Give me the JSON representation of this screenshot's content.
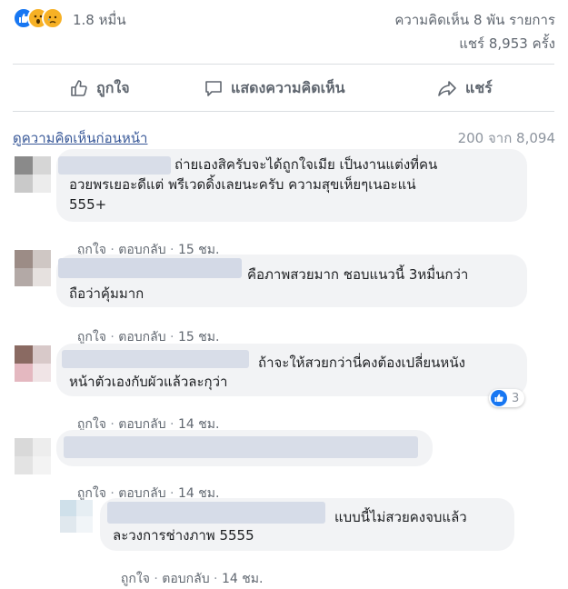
{
  "reactions": {
    "icons": [
      "like-icon",
      "wow-icon",
      "sad-icon"
    ],
    "count": "1.8 หมื่น",
    "comments_count": "ความคิดเห็น 8 พัน รายการ",
    "shares_count": "แชร์ 8,953 ครั้ง"
  },
  "actions": {
    "like": "ถูกใจ",
    "comment": "แสดงความคิดเห็น",
    "share": "แชร์"
  },
  "comments_header": {
    "view_previous": "ดูความคิดเห็นก่อนหน้า",
    "counter": "200 จาก 8,094"
  },
  "comments": [
    {
      "text_line1": "ถ่ายเองสิครับจะได้ถูกใจเมีย เป็นงานแต่งที่คน",
      "text_line2": "อวยพรเยอะดีแต่ พรีเวดดิ้งเลยนะครับ ความสุขเห็ยๆเนอะแน่",
      "text_line3": "555+",
      "like": "ถูกใจ",
      "reply": "ตอบกลับ",
      "time": "15 ชม."
    },
    {
      "text_line1": "คือภาพสวยมาก ชอบแนวนี้ 3หมื่นกว่า",
      "text_line2": "ถือว่าคุ้มมาก",
      "like": "ถูกใจ",
      "reply": "ตอบกลับ",
      "time": "15 ชม."
    },
    {
      "text_line1": "ถ้าจะให้สวยกว่านี่คงต้องเปลี่ยนหนัง",
      "text_line2": "หน้าตัวเองกับผัวแล้วละกุว่า",
      "reactions": "3",
      "like": "ถูกใจ",
      "reply": "ตอบกลับ",
      "time": "14 ชม."
    },
    {
      "like": "ถูกใจ",
      "reply": "ตอบกลับ",
      "time": "14 ชม."
    },
    {
      "text_line1": "แบบนี้ไม่สวยคงจบแล้ว",
      "text_line2": "ละวงการช่างภาพ 5555",
      "like": "ถูกใจ",
      "reply": "ตอบกลับ",
      "time": "14 ชม."
    }
  ],
  "colors": {
    "accent": "#1877f2",
    "link": "#385898",
    "bubble": "#f2f3f5",
    "muted": "#606770"
  }
}
